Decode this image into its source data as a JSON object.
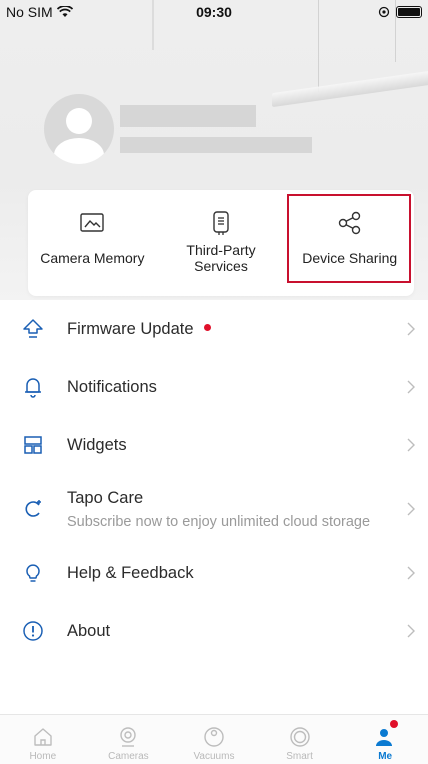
{
  "status_bar": {
    "carrier": "No SIM",
    "time": "09:30"
  },
  "quick_actions": [
    {
      "label": "Camera Memory",
      "icon": "camera-memory-icon"
    },
    {
      "label": "Third-Party Services",
      "icon": "third-party-services-icon"
    },
    {
      "label": "Device Sharing",
      "icon": "share-icon"
    }
  ],
  "menu": {
    "firmware_update": "Firmware Update",
    "notifications": "Notifications",
    "widgets": "Widgets",
    "tapo_care": "Tapo Care",
    "tapo_care_sub": "Subscribe now to enjoy unlimited cloud storage",
    "help_feedback": "Help & Feedback",
    "about": "About"
  },
  "tabs": [
    {
      "label": "Home",
      "icon": "home-icon"
    },
    {
      "label": "Cameras",
      "icon": "camera-icon"
    },
    {
      "label": "Vacuums",
      "icon": "vacuum-icon"
    },
    {
      "label": "Smart",
      "icon": "smart-icon"
    },
    {
      "label": "Me",
      "icon": "me-icon",
      "active": true
    }
  ],
  "colors": {
    "accent": "#0b7ad1",
    "highlight": "#c8102e",
    "badge": "#e0102a"
  }
}
